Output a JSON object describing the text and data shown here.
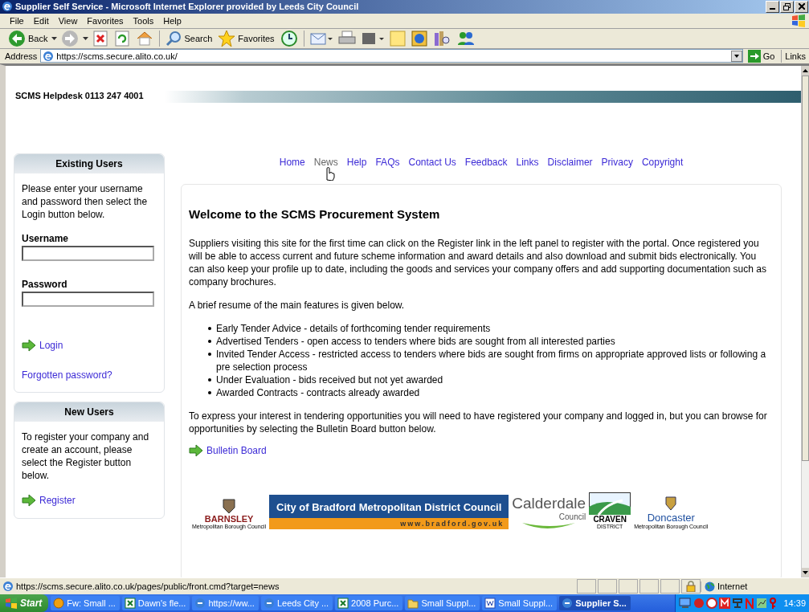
{
  "window": {
    "title": "Supplier Self Service - Microsoft Internet Explorer provided by Leeds City Council"
  },
  "menu": [
    "File",
    "Edit",
    "View",
    "Favorites",
    "Tools",
    "Help"
  ],
  "toolbar": [
    {
      "kind": "back",
      "label": "Back"
    },
    {
      "kind": "forward"
    },
    {
      "kind": "stop"
    },
    {
      "kind": "refresh"
    },
    {
      "kind": "home"
    },
    {
      "kind": "search",
      "label": "Search"
    },
    {
      "kind": "favorites",
      "label": "Favorites"
    },
    {
      "kind": "history"
    },
    {
      "kind": "mail"
    },
    {
      "kind": "print"
    },
    {
      "kind": "edit"
    },
    {
      "kind": "notes"
    },
    {
      "kind": "globe"
    },
    {
      "kind": "research"
    },
    {
      "kind": "messenger"
    }
  ],
  "address": {
    "label": "Address",
    "value": "https://scms.secure.alito.co.uk/",
    "go": "Go",
    "links": "Links"
  },
  "page": {
    "helpdesk": "SCMS Helpdesk 0113 247 4001",
    "existing_users": {
      "title": "Existing Users",
      "text": "Please enter your username and password then select the Login button below.",
      "username_label": "Username",
      "password_label": "Password",
      "login": "Login",
      "forgotten": "Forgotten password?"
    },
    "new_users": {
      "title": "New Users",
      "text": "To register your company and create an account, please select the Register button below.",
      "register": "Register"
    },
    "nav": [
      {
        "label": "Home",
        "hovered": false
      },
      {
        "label": "News",
        "hovered": true
      },
      {
        "label": "Help",
        "hovered": false
      },
      {
        "label": "FAQs",
        "hovered": false
      },
      {
        "label": "Contact Us",
        "hovered": false
      },
      {
        "label": "Feedback",
        "hovered": false
      },
      {
        "label": "Links",
        "hovered": false
      },
      {
        "label": "Disclaimer",
        "hovered": false
      },
      {
        "label": "Privacy",
        "hovered": false
      },
      {
        "label": "Copyright",
        "hovered": false
      }
    ],
    "welcome": {
      "title": "Welcome to the SCMS Procurement System",
      "intro": "Suppliers visiting this site for the first time can click on the Register link in the left panel to register with the portal. Once registered you will be able to access current and future scheme information and award details and also download and submit bids electronically. You can also keep your profile up to date, including the goods and services your company offers and add supporting documentation such as company brochures.",
      "resume": "A brief resume of the main features is given below.",
      "features": [
        "Early Tender Advice - details of forthcoming tender requirements",
        "Advertised Tenders - open access to tenders where bids are sought from all interested parties",
        "Invited Tender Access - restricted access to tenders where bids are sought from firms on appropriate approved lists or following a pre selection process",
        "Under Evaluation - bids received but not yet awarded",
        "Awarded Contracts - contracts already awarded"
      ],
      "interest": "To express your interest in tendering opportunities you will need to have registered your company and logged in, but you can browse for opportunities by selecting the Bulletin Board button below.",
      "bulletin": "Bulletin Board"
    },
    "logos": [
      {
        "kind": "barnsley",
        "name": "BARNSLEY",
        "sub": "Metropolitan Borough Council"
      },
      {
        "kind": "bradford",
        "name": "City of Bradford Metropolitan District Council",
        "sub": "www.bradford.gov.uk"
      },
      {
        "kind": "calderdale",
        "name": "Calderdale",
        "sub": "Council"
      },
      {
        "kind": "craven",
        "name": "CRAVEN",
        "sub": "DISTRICT"
      },
      {
        "kind": "doncaster",
        "name": "Doncaster",
        "sub": "Metropolitan Borough Council"
      }
    ]
  },
  "status_bar": {
    "url": "https://scms.secure.alito.co.uk/pages/public/front.cmd?target=news",
    "zone": "Internet"
  },
  "taskbar": {
    "start": "Start",
    "items": [
      {
        "kind": "outlook",
        "label": "Fw: Small ...",
        "selected": false
      },
      {
        "kind": "excel",
        "label": "Dawn's fle...",
        "selected": false
      },
      {
        "kind": "ie",
        "label": "https://ww...",
        "selected": false
      },
      {
        "kind": "ie",
        "label": "Leeds City ...",
        "selected": false
      },
      {
        "kind": "excel",
        "label": "2008 Purc...",
        "selected": false
      },
      {
        "kind": "folder",
        "label": "Small Suppl...",
        "selected": false
      },
      {
        "kind": "word",
        "label": "Small Suppl...",
        "selected": false
      },
      {
        "kind": "ie",
        "label": "Supplier S...",
        "selected": true
      }
    ],
    "clock": "14:39"
  }
}
